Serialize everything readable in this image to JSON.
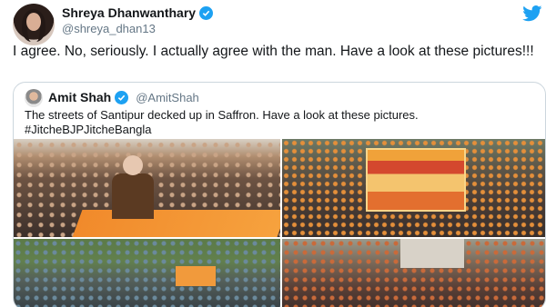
{
  "tweet": {
    "display_name": "Shreya Dhanwanthary",
    "handle": "@shreya_dhan13",
    "text": "I agree. No, seriously. I actually agree with the man. Have a look at these pictures!!!",
    "verified": true,
    "brand_icon": "twitter-bird-icon",
    "accent_color": "#1da1f2"
  },
  "quoted_tweet": {
    "display_name": "Amit Shah",
    "handle": "@AmitShah",
    "verified": true,
    "text": "The streets of Santipur decked up in Saffron. Have a look at these pictures.",
    "hashtag": "#JitcheBJPJitcheBangla"
  }
}
